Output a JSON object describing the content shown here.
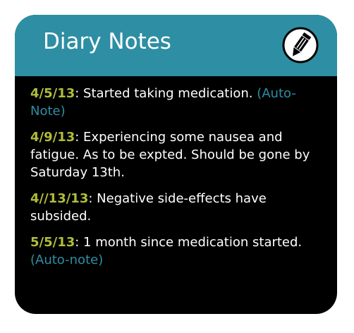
{
  "header": {
    "title": "Diary Notes",
    "icon": "pencil-icon"
  },
  "colors": {
    "header_bg": "#2e8ea3",
    "card_bg": "#000000",
    "date": "#b1bd39",
    "auto_note": "#2e8ea3",
    "text": "#ffffff"
  },
  "notes": [
    {
      "date": "4/5/13",
      "sep": ":",
      "text": " Started taking medication. ",
      "auto": "(Auto-Note)"
    },
    {
      "date": "4/9/13",
      "sep": ":",
      "text": " Experiencing some nausea and fatigue. As to be expted. Should be gone by Saturday 13th.",
      "auto": ""
    },
    {
      "date": "4//13/13",
      "sep": ":",
      "text": " Negative side-effects have subsided.",
      "auto": ""
    },
    {
      "date": "5/5/13",
      "sep": ":",
      "text": " 1 month since medication started. ",
      "auto": "(Auto-note)"
    }
  ]
}
